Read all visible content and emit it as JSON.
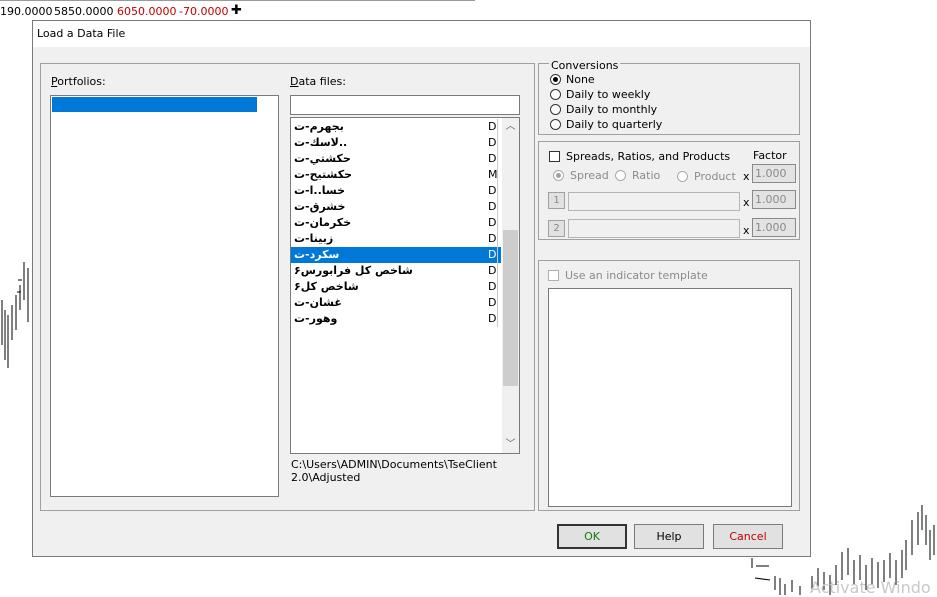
{
  "price_strip": {
    "values": [
      {
        "text": "190.0000",
        "color": "#000000"
      },
      {
        "text": "5850.0000",
        "color": "#000000"
      },
      {
        "text": "6050.0000",
        "color": "#c00000"
      },
      {
        "text": "-70.0000",
        "color": "#c00000"
      }
    ],
    "add_symbol": "✚"
  },
  "dialog": {
    "title": "Load a Data File",
    "portfolios": {
      "label_prefix": "",
      "label_hotkey": "P",
      "label_rest": "ortfolios:",
      "items": [
        ""
      ]
    },
    "data_files": {
      "label_hotkey": "D",
      "label_rest": "ata files:",
      "search_value": "",
      "files": [
        {
          "name": "بجهرم-ت",
          "type": "D"
        },
        {
          "name": "..لاسك-ت",
          "type": "D"
        },
        {
          "name": "حكشتي-ت",
          "type": "D"
        },
        {
          "name": "حكشتيح-ت",
          "type": "M"
        },
        {
          "name": "خسا..ا-ت",
          "type": "D"
        },
        {
          "name": "خشرق-ت",
          "type": "D"
        },
        {
          "name": "خكرمان-ت",
          "type": "D"
        },
        {
          "name": "زبينا-ت",
          "type": "D"
        },
        {
          "name": "سكرد-ت",
          "type": "D",
          "selected": true
        },
        {
          "name": "شاخص كل فرابورس۶",
          "type": "D"
        },
        {
          "name": "شاخص كل۶",
          "type": "D"
        },
        {
          "name": "غشان-ت",
          "type": "D"
        },
        {
          "name": "وهور-ت",
          "type": "D"
        }
      ],
      "path": "C:\\Users\\ADMIN\\Documents\\TseClient\n2.0\\Adjusted"
    },
    "conversions": {
      "title": "Conversions",
      "options": [
        {
          "label": "None",
          "checked": true
        },
        {
          "label": "Daily to weekly",
          "checked": false
        },
        {
          "label": "Daily to monthly",
          "checked": false
        },
        {
          "label": "Daily to quarterly",
          "checked": false
        }
      ]
    },
    "spreads": {
      "checkbox_label": "Spreads, Ratios, and Products",
      "factor_label": "Factor",
      "modes": [
        {
          "label": "Spread",
          "checked": true
        },
        {
          "label": "Ratio",
          "checked": false
        },
        {
          "label": "Product",
          "checked": false
        }
      ],
      "factor_values": [
        "1.000",
        "1.000",
        "1.000"
      ],
      "row_buttons": [
        "1",
        "2"
      ],
      "times_symbol": "x"
    },
    "indicator": {
      "checkbox_label": "Use an indicator template"
    },
    "buttons": {
      "ok": "OK",
      "help": "Help",
      "cancel": "Cancel"
    }
  },
  "watermark": "Activate Windo"
}
